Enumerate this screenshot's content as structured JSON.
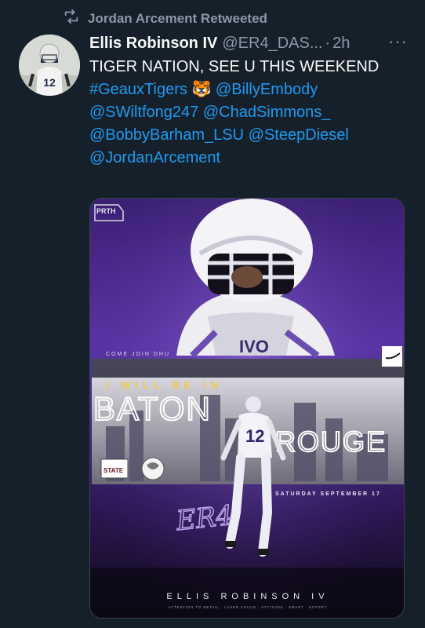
{
  "retweet": {
    "label": "Jordan Arcement Retweeted"
  },
  "tweet": {
    "author_name": "Ellis Robinson IV",
    "author_handle": "@ER4_DAS...",
    "separator": "·",
    "time": "2h",
    "more": "···",
    "text_line1": "TIGER NATION, SEE U THIS WEEKEND",
    "tags": {
      "t1": "#GeauxTigers",
      "emoji": "🐯",
      "t2": "@BillyEmbody",
      "t3": "@SWiltfong247",
      "t4": "@ChadSimmons_",
      "t5": "@BobbyBarham_LSU",
      "t6": "@SteepDiesel",
      "t7": "@JordanArcement"
    }
  },
  "media": {
    "logo_text": "PRTH",
    "come_join": "COME JOIN DHU",
    "will_be": "I WILL BE IN",
    "baton": "BATON",
    "rouge": "ROUGE",
    "jersey": "12",
    "date": "SATURDAY SEPTEMBER 17",
    "school_mark": "STATE",
    "signature": "ER4",
    "player_name": "ELLIS ROBINSON IV",
    "tagline": "ATTENTION TO DETAIL · LASER FOCUS · ATTITUDE · SMART · EFFORT"
  },
  "colors": {
    "background": "#15202b",
    "link": "#1d9bf0",
    "muted": "#8b98a5",
    "purple": "#5b2fa0"
  }
}
